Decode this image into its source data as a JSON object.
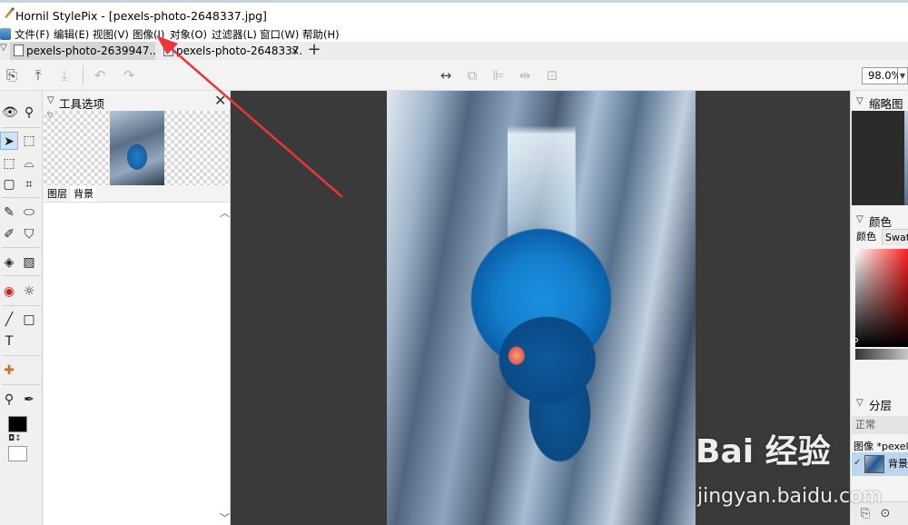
{
  "window": {
    "title": "Hornil StylePix - [pexels-photo-2648337.jpg]",
    "app_icon": "brush-icon"
  },
  "menu": {
    "items": [
      {
        "label": "文件(F)"
      },
      {
        "label": "编辑(E)"
      },
      {
        "label": "视图(V)"
      },
      {
        "label": "图像(I)"
      },
      {
        "label": "对象(O)"
      },
      {
        "label": "过滤器(L)"
      },
      {
        "label": "窗口(W)"
      },
      {
        "label": "帮助(H)"
      }
    ]
  },
  "doc_tabs": {
    "tab1": "pexels-photo-2639947...",
    "tab2": "pexels-photo-2648337...",
    "tab2_close": "×",
    "add": "+"
  },
  "toolbar": {
    "zoom": "98.0%",
    "icons": [
      "new-document-icon",
      "export-icon",
      "import-icon",
      "undo-icon",
      "redo-icon",
      "fit-width-icon",
      "copy-layer-icon",
      "align-icon",
      "distribute-icon",
      "fit-canvas-icon"
    ]
  },
  "tool_options": {
    "title": "工具选项",
    "tabs": [
      "图层",
      "背景"
    ]
  },
  "right_panels": {
    "navigator_title": "缩略图",
    "color_title": "颜色",
    "color_tabs": [
      "颜色",
      "Swatch"
    ],
    "layers_title": "分层",
    "blend_mode": "正常",
    "layer_group": "图像 *pexels",
    "layer_name": "背景"
  },
  "watermark": {
    "logo": "Bai 经验",
    "url": "jingyan.baidu.com"
  },
  "colors": {
    "foreground": "#000000",
    "background": "#ffffff",
    "annotation_arrow": "#e8363a"
  }
}
